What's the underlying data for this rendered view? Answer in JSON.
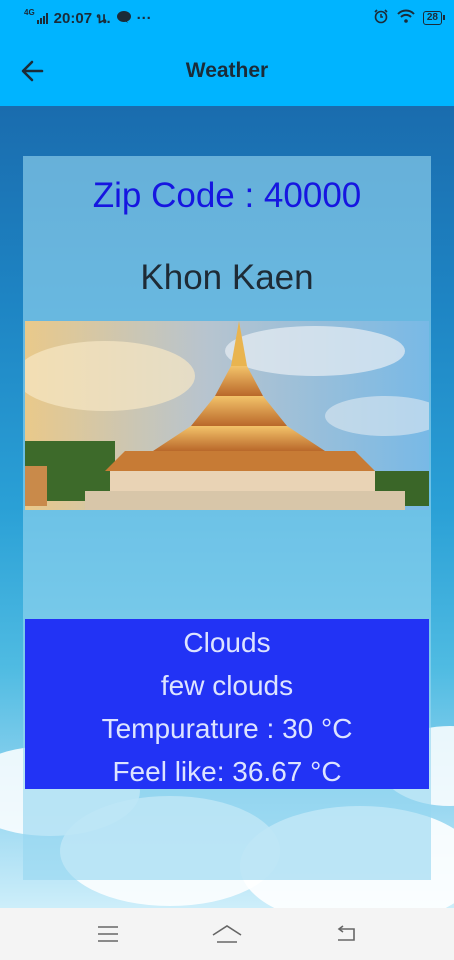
{
  "status_bar": {
    "network": "4G",
    "time_text": "20:07 น.",
    "battery": "28"
  },
  "app_bar": {
    "title": "Weather"
  },
  "location": {
    "zip_text": "Zip Code : 40000",
    "city": "Khon Kaen"
  },
  "weather": {
    "main": "Clouds",
    "description": "few clouds",
    "temperature_text": "Tempurature : 30 °C",
    "feels_like_text": "Feel like: 36.67 °C"
  },
  "colors": {
    "app_bar": "#00b4ff",
    "zip_text": "#1616e0",
    "weather_box": "#2233f5"
  }
}
